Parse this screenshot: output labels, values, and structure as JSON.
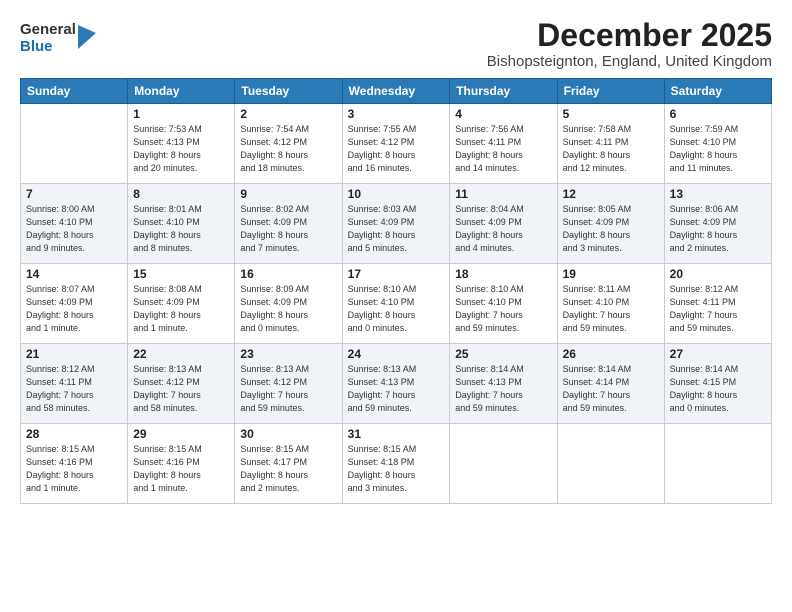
{
  "logo": {
    "general": "General",
    "blue": "Blue"
  },
  "title": "December 2025",
  "location": "Bishopsteignton, England, United Kingdom",
  "weekdays": [
    "Sunday",
    "Monday",
    "Tuesday",
    "Wednesday",
    "Thursday",
    "Friday",
    "Saturday"
  ],
  "weeks": [
    [
      {
        "day": "",
        "info": ""
      },
      {
        "day": "1",
        "info": "Sunrise: 7:53 AM\nSunset: 4:13 PM\nDaylight: 8 hours\nand 20 minutes."
      },
      {
        "day": "2",
        "info": "Sunrise: 7:54 AM\nSunset: 4:12 PM\nDaylight: 8 hours\nand 18 minutes."
      },
      {
        "day": "3",
        "info": "Sunrise: 7:55 AM\nSunset: 4:12 PM\nDaylight: 8 hours\nand 16 minutes."
      },
      {
        "day": "4",
        "info": "Sunrise: 7:56 AM\nSunset: 4:11 PM\nDaylight: 8 hours\nand 14 minutes."
      },
      {
        "day": "5",
        "info": "Sunrise: 7:58 AM\nSunset: 4:11 PM\nDaylight: 8 hours\nand 12 minutes."
      },
      {
        "day": "6",
        "info": "Sunrise: 7:59 AM\nSunset: 4:10 PM\nDaylight: 8 hours\nand 11 minutes."
      }
    ],
    [
      {
        "day": "7",
        "info": "Sunrise: 8:00 AM\nSunset: 4:10 PM\nDaylight: 8 hours\nand 9 minutes."
      },
      {
        "day": "8",
        "info": "Sunrise: 8:01 AM\nSunset: 4:10 PM\nDaylight: 8 hours\nand 8 minutes."
      },
      {
        "day": "9",
        "info": "Sunrise: 8:02 AM\nSunset: 4:09 PM\nDaylight: 8 hours\nand 7 minutes."
      },
      {
        "day": "10",
        "info": "Sunrise: 8:03 AM\nSunset: 4:09 PM\nDaylight: 8 hours\nand 5 minutes."
      },
      {
        "day": "11",
        "info": "Sunrise: 8:04 AM\nSunset: 4:09 PM\nDaylight: 8 hours\nand 4 minutes."
      },
      {
        "day": "12",
        "info": "Sunrise: 8:05 AM\nSunset: 4:09 PM\nDaylight: 8 hours\nand 3 minutes."
      },
      {
        "day": "13",
        "info": "Sunrise: 8:06 AM\nSunset: 4:09 PM\nDaylight: 8 hours\nand 2 minutes."
      }
    ],
    [
      {
        "day": "14",
        "info": "Sunrise: 8:07 AM\nSunset: 4:09 PM\nDaylight: 8 hours\nand 1 minute."
      },
      {
        "day": "15",
        "info": "Sunrise: 8:08 AM\nSunset: 4:09 PM\nDaylight: 8 hours\nand 1 minute."
      },
      {
        "day": "16",
        "info": "Sunrise: 8:09 AM\nSunset: 4:09 PM\nDaylight: 8 hours\nand 0 minutes."
      },
      {
        "day": "17",
        "info": "Sunrise: 8:10 AM\nSunset: 4:10 PM\nDaylight: 8 hours\nand 0 minutes."
      },
      {
        "day": "18",
        "info": "Sunrise: 8:10 AM\nSunset: 4:10 PM\nDaylight: 7 hours\nand 59 minutes."
      },
      {
        "day": "19",
        "info": "Sunrise: 8:11 AM\nSunset: 4:10 PM\nDaylight: 7 hours\nand 59 minutes."
      },
      {
        "day": "20",
        "info": "Sunrise: 8:12 AM\nSunset: 4:11 PM\nDaylight: 7 hours\nand 59 minutes."
      }
    ],
    [
      {
        "day": "21",
        "info": "Sunrise: 8:12 AM\nSunset: 4:11 PM\nDaylight: 7 hours\nand 58 minutes."
      },
      {
        "day": "22",
        "info": "Sunrise: 8:13 AM\nSunset: 4:12 PM\nDaylight: 7 hours\nand 58 minutes."
      },
      {
        "day": "23",
        "info": "Sunrise: 8:13 AM\nSunset: 4:12 PM\nDaylight: 7 hours\nand 59 minutes."
      },
      {
        "day": "24",
        "info": "Sunrise: 8:13 AM\nSunset: 4:13 PM\nDaylight: 7 hours\nand 59 minutes."
      },
      {
        "day": "25",
        "info": "Sunrise: 8:14 AM\nSunset: 4:13 PM\nDaylight: 7 hours\nand 59 minutes."
      },
      {
        "day": "26",
        "info": "Sunrise: 8:14 AM\nSunset: 4:14 PM\nDaylight: 7 hours\nand 59 minutes."
      },
      {
        "day": "27",
        "info": "Sunrise: 8:14 AM\nSunset: 4:15 PM\nDaylight: 8 hours\nand 0 minutes."
      }
    ],
    [
      {
        "day": "28",
        "info": "Sunrise: 8:15 AM\nSunset: 4:16 PM\nDaylight: 8 hours\nand 1 minute."
      },
      {
        "day": "29",
        "info": "Sunrise: 8:15 AM\nSunset: 4:16 PM\nDaylight: 8 hours\nand 1 minute."
      },
      {
        "day": "30",
        "info": "Sunrise: 8:15 AM\nSunset: 4:17 PM\nDaylight: 8 hours\nand 2 minutes."
      },
      {
        "day": "31",
        "info": "Sunrise: 8:15 AM\nSunset: 4:18 PM\nDaylight: 8 hours\nand 3 minutes."
      },
      {
        "day": "",
        "info": ""
      },
      {
        "day": "",
        "info": ""
      },
      {
        "day": "",
        "info": ""
      }
    ]
  ]
}
